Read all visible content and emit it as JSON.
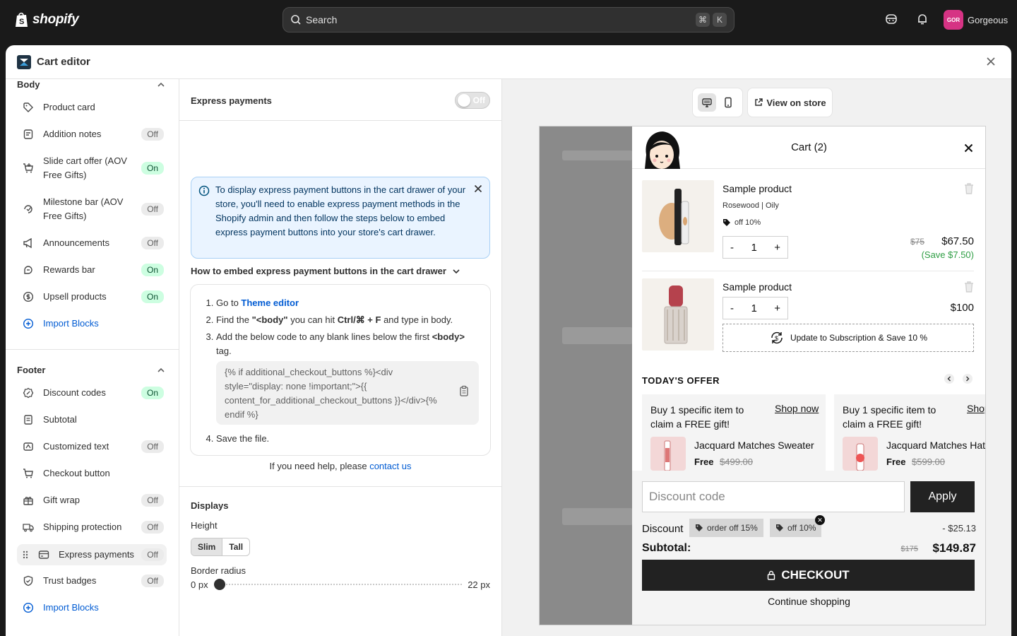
{
  "topbar": {
    "logo_text": "shopify",
    "search_placeholder": "Search",
    "shortcut_keys": [
      "⌘",
      "K"
    ],
    "avatar_initials": "GOR",
    "store_name": "Gorgeous"
  },
  "modal": {
    "title": "Cart editor"
  },
  "sidebar": {
    "body_section": {
      "title": "Body",
      "items": [
        {
          "label": "Product card",
          "status": "",
          "icon": "tag-icon"
        },
        {
          "label": "Addition notes",
          "status": "Off",
          "icon": "note-icon"
        },
        {
          "label": "Slide cart offer (AOV Free Gifts)",
          "status": "On",
          "icon": "cart-plus-icon"
        },
        {
          "label": "Milestone bar (AOV Free Gifts)",
          "status": "Off",
          "icon": "milestone-icon"
        },
        {
          "label": "Announcements",
          "status": "Off",
          "icon": "megaphone-icon"
        },
        {
          "label": "Rewards bar",
          "status": "On",
          "icon": "reward-icon"
        },
        {
          "label": "Upsell products",
          "status": "On",
          "icon": "dollar-icon"
        }
      ],
      "import_label": "Import Blocks"
    },
    "footer_section": {
      "title": "Footer",
      "items": [
        {
          "label": "Discount codes",
          "status": "On",
          "icon": "discount-icon"
        },
        {
          "label": "Subtotal",
          "status": "",
          "icon": "receipt-icon"
        },
        {
          "label": "Customized text",
          "status": "Off",
          "icon": "text-icon"
        },
        {
          "label": "Checkout button",
          "status": "",
          "icon": "cart-icon"
        },
        {
          "label": "Gift wrap",
          "status": "Off",
          "icon": "gift-icon"
        },
        {
          "label": "Shipping protection",
          "status": "Off",
          "icon": "truck-icon"
        },
        {
          "label": "Express payments",
          "status": "Off",
          "icon": "card-icon"
        },
        {
          "label": "Trust badges",
          "status": "Off",
          "icon": "shield-icon"
        }
      ],
      "import_label": "Import Blocks"
    }
  },
  "settings": {
    "express_title": "Express payments",
    "toggle_label": "Off",
    "info_text": "To display express payment buttons in the cart drawer of your store, you'll need to enable express payment methods in the Shopify admin and then follow the steps below to embed express payment buttons into your store's cart drawer.",
    "howto_title": "How to embed express payment buttons in the cart drawer",
    "step1_prefix": "Go to ",
    "step1_link": "Theme editor",
    "step2_a": "Find the ",
    "step2_b": "\"<body\"",
    "step2_c": " you can hit ",
    "step2_d": "Ctrl/⌘ + F",
    "step2_e": " and type in body.",
    "step3_a": "Add the below code to any blank lines below the first ",
    "step3_b": "<body>",
    "step3_c": " tag.",
    "code": "{% if additional_checkout_buttons %}<div style=\"display: none !important;\">{{ content_for_additional_checkout_buttons }}</div>{% endif %}",
    "step4": "Save the file.",
    "help_prefix": "If you need help, please ",
    "help_link": "contact us",
    "displays_title": "Displays",
    "height_label": "Height",
    "height_options": [
      "Slim",
      "Tall"
    ],
    "border_radius_label": "Border radius",
    "radius_min": "0 px",
    "radius_max": "22 px",
    "radius_value_fraction": 0
  },
  "preview": {
    "view_on_store": "View on store",
    "cart_title": "Cart (2)",
    "products": [
      {
        "name": "Sample product",
        "variant": "Rosewood | Oily",
        "discount_tag": "off 10%",
        "qty": "1",
        "old_price": "$75",
        "price": "$67.50",
        "save": "(Save $7.50)"
      },
      {
        "name": "Sample product",
        "qty": "1",
        "price": "$100",
        "subscription": "Update to Subscription & Save 10 %"
      }
    ],
    "offers_title": "TODAY'S OFFER",
    "offers": [
      {
        "title": "Buy 1 specific item to claim a FREE gift!",
        "shop": "Shop now",
        "item": "Jacquard Matches Sweater",
        "free": "Free",
        "old": "$499.00"
      },
      {
        "title": "Buy 1 specific item to claim a FREE gift!",
        "shop": "Shop now",
        "item": "Jacquard Matches Hat",
        "free": "Free",
        "old": "$599.00"
      }
    ],
    "discount_placeholder": "Discount code",
    "apply": "Apply",
    "discount_label": "Discount",
    "discount_tags": [
      "order off 15%",
      "off 10%"
    ],
    "discount_amount": "- $25.13",
    "subtotal_label": "Subtotal:",
    "subtotal_old": "$175",
    "subtotal": "$149.87",
    "checkout": "CHECKOUT",
    "continue": "Continue shopping"
  },
  "colors": {
    "on_badge": "#cdfee1",
    "off_badge": "#ebebeb",
    "link": "#005bd3",
    "info_bg": "#eaf4ff",
    "checkout_bg": "#222222"
  }
}
